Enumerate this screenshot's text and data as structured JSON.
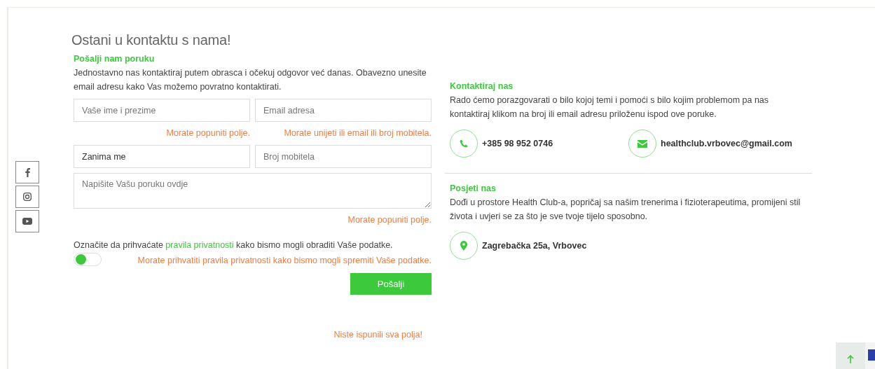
{
  "title": "Ostani u kontaktu s nama!",
  "social": [
    {
      "kind": "facebook"
    },
    {
      "kind": "instagram"
    },
    {
      "kind": "youtube"
    }
  ],
  "form": {
    "heading": "Pošalji nam poruku",
    "intro": "Jednostavno nas kontaktiraj putem obrasca i očekuj odgovor već danas. Obavezno unesite email adresu kako Vas možemo povratno kontaktirati.",
    "rows": [
      {
        "fields": [
          {
            "kind": "input",
            "placeholder": "Vaše ime i prezime",
            "error": "Morate popuniti polje."
          },
          {
            "kind": "input",
            "placeholder": "Email adresa",
            "error": "Morate unijeti ili email ili broj mobitela."
          }
        ]
      },
      {
        "fields": [
          {
            "kind": "select",
            "value": "Zanima me"
          },
          {
            "kind": "input",
            "placeholder": "Broj mobitela"
          }
        ]
      },
      {
        "fields": [
          {
            "kind": "textarea",
            "placeholder": "Napišite Vašu poruku ovdje",
            "error": "Morate popuniti polje."
          }
        ]
      }
    ],
    "consent": {
      "before": "Označite da prihvaćate ",
      "link": "pravila privatnosti",
      "after": " kako bismo mogli obraditi Vaše podatke.",
      "on": false,
      "error": "Morate prihvatiti pravila privatnosti kako bismo mogli spremiti Vaše podatke."
    },
    "submit": "Pošalji",
    "form_error": "Niste ispunili sva polja!"
  },
  "contact": {
    "heading": "Kontaktiraj nas",
    "text": "Rado ćemo porazgovarati o bilo kojoj temi i pomoći s bilo kojim problemom pa nas kontaktiraj klikom na broj ili email adresu priloženu ispod ove poruke.",
    "items": [
      {
        "kind": "phone",
        "label": "+385 98 952 0746"
      },
      {
        "kind": "email",
        "label": "healthclub.vrbovec@gmail.com"
      }
    ]
  },
  "visit": {
    "heading": "Posjeti nas",
    "text": "Dođi u prostore Health Club-a, popričaj sa našim trenerima i fizioterapeutima, promijeni stil života i uvjeri se za što je sve tvoje tijelo sposobno.",
    "items": [
      {
        "kind": "location",
        "label": "Zagrebačka 25a, Vrbovec"
      }
    ]
  }
}
